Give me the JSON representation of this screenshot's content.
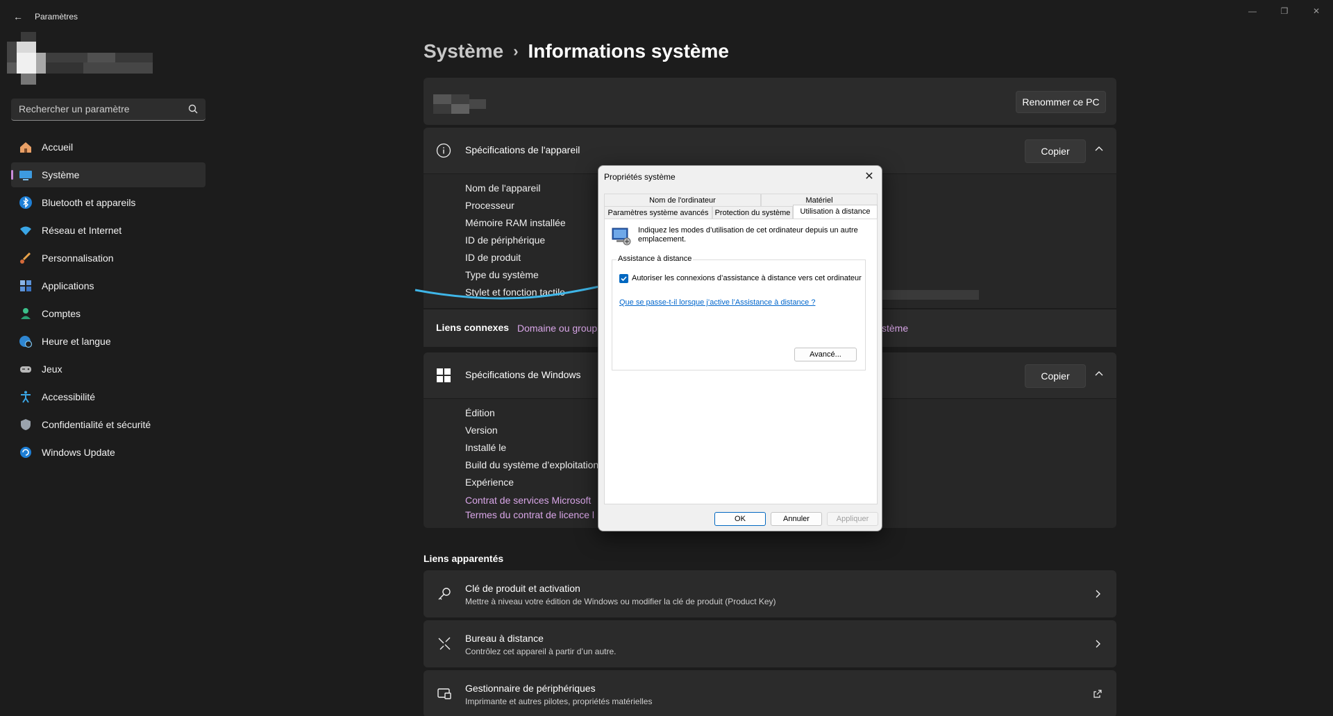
{
  "window": {
    "app_title": "Paramètres",
    "back_glyph": "←",
    "controls": {
      "minimize": "—",
      "maximize": "❐",
      "close": "✕"
    }
  },
  "search": {
    "placeholder": "Rechercher un paramètre",
    "icon": "search-icon"
  },
  "sidebar": {
    "items": [
      {
        "label": "Accueil",
        "icon": "home-icon"
      },
      {
        "label": "Système",
        "icon": "monitor-icon",
        "active": true
      },
      {
        "label": "Bluetooth et appareils",
        "icon": "bluetooth-icon"
      },
      {
        "label": "Réseau et Internet",
        "icon": "wifi-icon"
      },
      {
        "label": "Personnalisation",
        "icon": "brush-icon"
      },
      {
        "label": "Applications",
        "icon": "apps-icon"
      },
      {
        "label": "Comptes",
        "icon": "person-icon"
      },
      {
        "label": "Heure et langue",
        "icon": "globe-clock-icon"
      },
      {
        "label": "Jeux",
        "icon": "gamepad-icon"
      },
      {
        "label": "Accessibilité",
        "icon": "accessibility-icon"
      },
      {
        "label": "Confidentialité et sécurité",
        "icon": "shield-icon"
      },
      {
        "label": "Windows Update",
        "icon": "update-icon"
      }
    ]
  },
  "breadcrumb": {
    "parent": "Système",
    "separator": "›",
    "current": "Informations système"
  },
  "pc_card": {
    "rename_label": "Renommer ce PC"
  },
  "device_specs": {
    "title": "Spécifications de l'appareil",
    "copy_label": "Copier",
    "rows": [
      "Nom de l'appareil",
      "Processeur",
      "Mémoire RAM installée",
      "ID de périphérique",
      "ID de produit",
      "Type du système",
      "Stylet et fonction tactile"
    ]
  },
  "related_links": {
    "label": "Liens connexes",
    "link1": "Domaine ou group",
    "link2": "stème"
  },
  "windows_specs": {
    "title": "Spécifications de Windows",
    "copy_label": "Copier",
    "rows": [
      "Édition",
      "Version",
      "Installé le",
      "Build du système d’exploitation",
      "Expérience"
    ],
    "links": [
      "Contrat de services Microsoft",
      "Termes du contrat de licence l"
    ]
  },
  "liens_apparentes": {
    "title": "Liens apparentés",
    "items": [
      {
        "title": "Clé de produit et activation",
        "subtitle": "Mettre à niveau votre édition de Windows ou modifier la clé de produit (Product Key)",
        "icon": "key-icon",
        "action": "chevron-right-icon"
      },
      {
        "title": "Bureau à distance",
        "subtitle": "Contrôlez cet appareil à partir d’un autre.",
        "icon": "remote-desktop-icon",
        "action": "chevron-right-icon"
      },
      {
        "title": "Gestionnaire de périphériques",
        "subtitle": "Imprimante et autres pilotes, propriétés matérielles",
        "icon": "device-manager-icon",
        "action": "external-link-icon"
      }
    ]
  },
  "dialog": {
    "title": "Propriétés système",
    "tabs_row1": [
      "Nom de l'ordinateur",
      "Matériel"
    ],
    "tabs_row2": [
      "Paramètres système avancés",
      "Protection du système",
      "Utilisation à distance"
    ],
    "active_tab": "Utilisation à distance",
    "description": "Indiquez les modes d’utilisation de cet ordinateur depuis un autre emplacement.",
    "group_label": "Assistance à distance",
    "checkbox_label": "Autoriser les connexions d’assistance à distance vers cet ordinateur",
    "checkbox_checked": true,
    "help_link": "Que se passe-t-il lorsque j’active l’Assistance à distance ?",
    "advanced_label": "Avancé...",
    "ok_label": "OK",
    "cancel_label": "Annuler",
    "apply_label": "Appliquer"
  },
  "colors": {
    "accent": "#c88ad9",
    "link": "#d9a6e8",
    "arrow": "#3fb6e8",
    "dialog_link": "#0066cc"
  }
}
